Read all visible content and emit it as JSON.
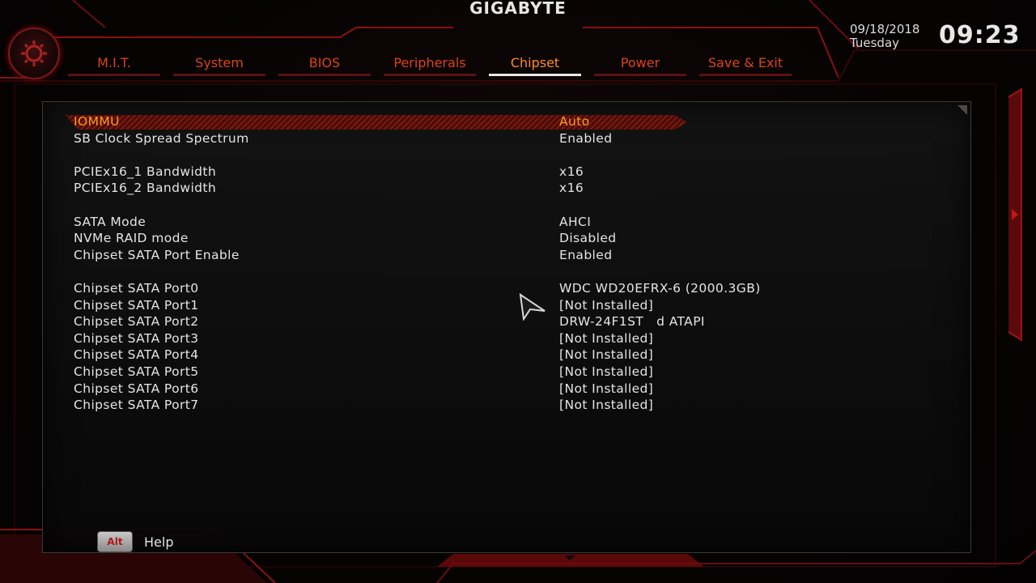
{
  "brand": "GIGABYTE",
  "tabs": [
    {
      "label": "M.I.T."
    },
    {
      "label": "System"
    },
    {
      "label": "BIOS"
    },
    {
      "label": "Peripherals"
    },
    {
      "label": "Chipset"
    },
    {
      "label": "Power"
    },
    {
      "label": "Save & Exit"
    }
  ],
  "active_tab": "Chipset",
  "date": "09/18/2018",
  "day": "Tuesday",
  "time": "09:23",
  "settings": [
    {
      "label": "IOMMU",
      "value": "Auto"
    },
    {
      "label": "SB Clock Spread Spectrum",
      "value": "Enabled"
    },
    {
      "label": "PCIEx16_1 Bandwidth",
      "value": "x16"
    },
    {
      "label": "PCIEx16_2 Bandwidth",
      "value": "x16"
    },
    {
      "label": "SATA Mode",
      "value": "AHCI"
    },
    {
      "label": "NVMe RAID mode",
      "value": "Disabled"
    },
    {
      "label": "Chipset SATA Port Enable",
      "value": "Enabled"
    },
    {
      "label": "Chipset SATA Port0",
      "value": "WDC WD20EFRX-6 (2000.3GB)"
    },
    {
      "label": "Chipset SATA Port1",
      "value": "[Not Installed]"
    },
    {
      "label": "Chipset SATA Port2",
      "value": "DRW-24F1ST   d ATAPI"
    },
    {
      "label": "Chipset SATA Port3",
      "value": "[Not Installed]"
    },
    {
      "label": "Chipset SATA Port4",
      "value": "[Not Installed]"
    },
    {
      "label": "Chipset SATA Port5",
      "value": "[Not Installed]"
    },
    {
      "label": "Chipset SATA Port6",
      "value": "[Not Installed]"
    },
    {
      "label": "Chipset SATA Port7",
      "value": "[Not Installed]"
    }
  ],
  "help": {
    "key": "Alt",
    "label": "Help"
  },
  "colors": {
    "accent": "#d9441a",
    "selected": "#ff9a20",
    "frame": "#8b0000"
  }
}
